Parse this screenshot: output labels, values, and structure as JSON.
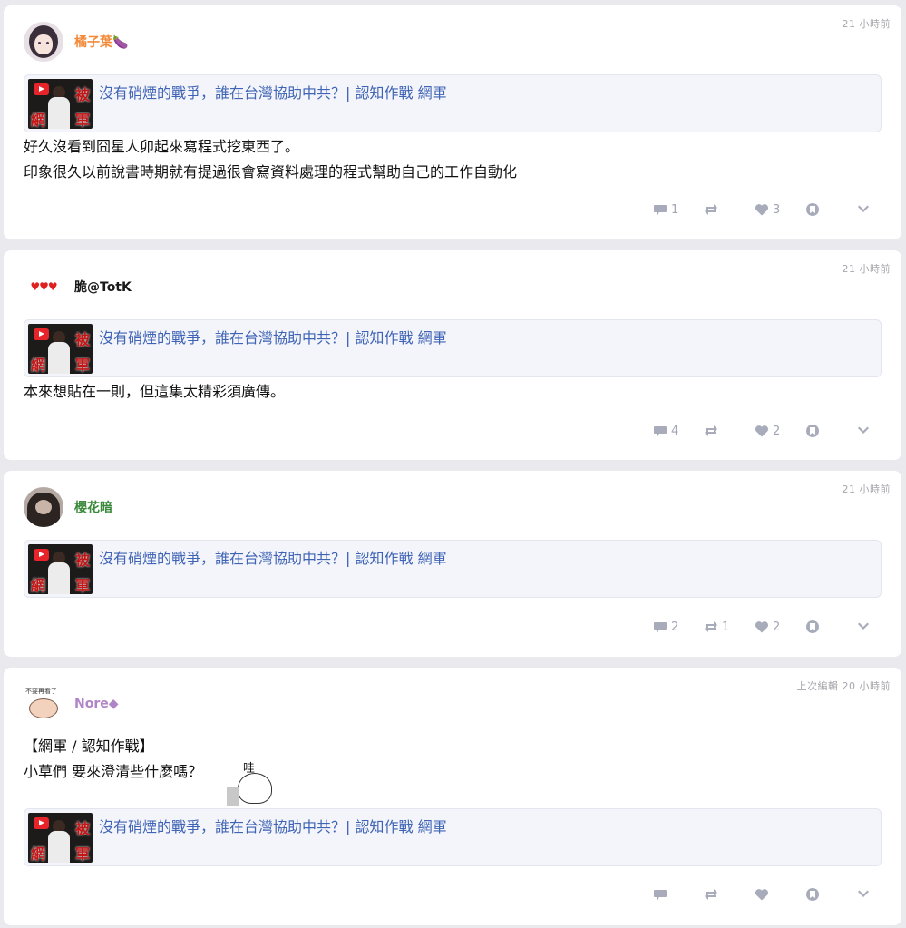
{
  "link_card": {
    "title": "沒有硝煙的戰爭，誰在台灣協助中共？| 認知作戰 網軍"
  },
  "posts": [
    {
      "author": "橘子葉🍆",
      "time": "21 小時前",
      "content": [
        "好久沒看到囧星人卯起來寫程式挖東西了。",
        "印象很久以前說書時期就有提過很會寫資料處理的程式幫助自己的工作自動化"
      ],
      "reply_count": "1",
      "boost_count": "",
      "like_count": "3"
    },
    {
      "author": "脆@TotK",
      "avatar_text": "♥♥♥",
      "time": "21 小時前",
      "content": [
        "本來想貼在一則，但這集太精彩須廣傳。"
      ],
      "reply_count": "4",
      "boost_count": "",
      "like_count": "2"
    },
    {
      "author": "櫻花暗",
      "time": "21 小時前",
      "content": [],
      "reply_count": "2",
      "boost_count": "1",
      "like_count": "2"
    },
    {
      "author": "Nore◆",
      "avatar_text": "不要再看了",
      "time": "上次編輯 20 小時前",
      "content": [
        "【網軍 / 認知作戰】",
        "小草們 要來澄清些什麼嗎？"
      ],
      "sticker_text": "哇",
      "reply_count": "",
      "boost_count": "",
      "like_count": ""
    }
  ],
  "colors": {
    "link": "#3f64b5",
    "post1_name": "#f28a3a",
    "post3_name": "#3b8a3b",
    "post4_name": "#b085c8",
    "icon": "#a7abba"
  },
  "icons": [
    "reply-icon",
    "boost-icon",
    "heart-icon",
    "bookmark-icon",
    "chevron-down-icon"
  ]
}
